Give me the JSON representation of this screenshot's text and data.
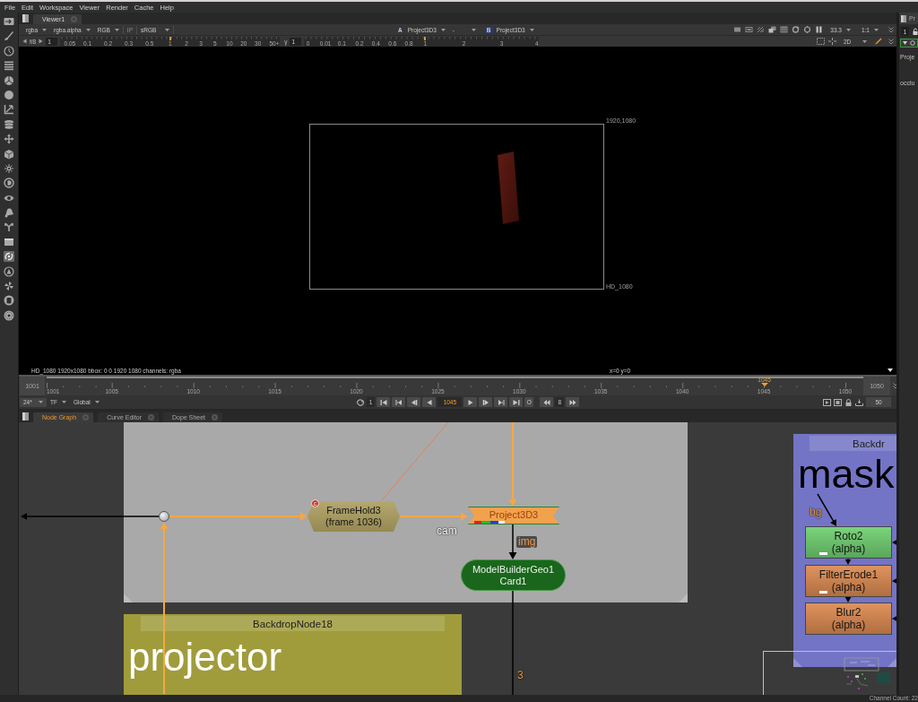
{
  "menu": [
    "File",
    "Edit",
    "Workspace",
    "Viewer",
    "Render",
    "Cache",
    "Help"
  ],
  "viewer": {
    "tabs": [
      {
        "label": "Viewer1",
        "selected": true
      }
    ],
    "channels": "rgba",
    "matte": "rgba.alpha",
    "display": "RGB",
    "ip": {
      "label": "IP",
      "disabled": true
    },
    "lut": "sRGB",
    "input_a": {
      "letter": "A",
      "node": "Project3D3"
    },
    "blend": "-",
    "input_b": {
      "letter": "B",
      "node": "Project3D3"
    },
    "zoom": "33.3",
    "ratio": "1:1",
    "fstop": "f/8",
    "gain": {
      "value": "1",
      "level": 0.5,
      "ticks": [
        "0.05",
        "0.1",
        "0.2",
        "0.3",
        "0.5",
        "1",
        "2",
        "3",
        "5",
        "10",
        "20",
        "30",
        "50+"
      ]
    },
    "gamma": {
      "symbol": "γ",
      "value": "1",
      "level": 0.515,
      "ticks": [
        "0",
        "0.01",
        "0.1",
        "0.2",
        "0.4",
        "0.6",
        "0.8",
        "1",
        "2",
        "3",
        "4"
      ]
    },
    "view_mode": "2D",
    "format": {
      "size": "1920,1080",
      "name": "HD_1080"
    },
    "info": "HD_1080 1920x1080 bbox: 0 0 1920 1080 channels: rgba",
    "coords": "x=0 y=0"
  },
  "timeline": {
    "start": "1001",
    "end": "1050",
    "labels": [
      "1001",
      "1005",
      "1010",
      "1015",
      "1020",
      "1025",
      "1030",
      "1035",
      "1040",
      "1045",
      "1050"
    ],
    "current": "1045",
    "level": 0.898
  },
  "transport": {
    "fps": "24*",
    "tf": "TF",
    "scope": "Global",
    "step": "1",
    "frame": "1045",
    "toggle": "O",
    "increment": "8",
    "range": "50"
  },
  "node_graph": {
    "tabs": [
      {
        "label": "Node Graph",
        "selected": true
      },
      {
        "label": "Curve Editor",
        "selected": false
      },
      {
        "label": "Dope Sheet",
        "selected": false
      }
    ],
    "backdrops": [
      {
        "color": "#a9a9a9"
      },
      {
        "label": "BackdropNode18",
        "note": "projector",
        "color": "#a09c3c"
      },
      {
        "label": "Backdr",
        "note": "mask",
        "color": "#7474c6"
      }
    ],
    "nodes": [
      {
        "kind": "dot"
      },
      {
        "kind": "hexagon",
        "label": "FrameHold3",
        "sub": "(frame 1036)",
        "color": "#aa9c5c",
        "badge": "c"
      },
      {
        "kind": "tag",
        "label": "Project3D3",
        "color": "#f2a24c"
      },
      {
        "kind": "pill",
        "label": "ModelBuilderGeo1",
        "sub": "Card1",
        "color": "#1a661c"
      },
      {
        "kind": "box",
        "label": "Roto2",
        "sub": "(alpha)",
        "color": "#70d070",
        "masked": true
      },
      {
        "kind": "box",
        "label": "FilterErode1",
        "sub": "(alpha)",
        "color": "#dc8a50",
        "masked": true
      },
      {
        "kind": "box",
        "label": "Blur2",
        "sub": "(alpha)",
        "color": "#dc8a50",
        "masked": false
      }
    ],
    "edge_labels": [
      {
        "text": "cam",
        "kind": "plain"
      },
      {
        "text": "img",
        "kind": "input"
      },
      {
        "text": "bg",
        "kind": "input"
      },
      {
        "text": "3",
        "kind": "input"
      }
    ]
  },
  "properties": {
    "tab": "Pr",
    "panels": "1",
    "node_tab": "Proje",
    "knob": "occlu"
  },
  "status_bar": {
    "channel_count": "Channel Count: 22"
  }
}
